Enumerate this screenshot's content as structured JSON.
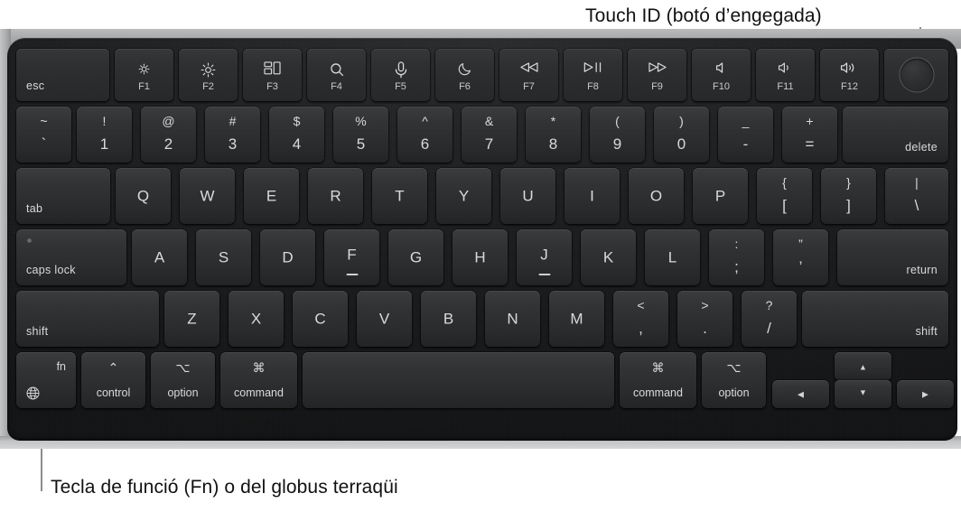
{
  "callouts": {
    "touch_id": "Touch ID (botó d’engegada)",
    "fn_key": "Tecla de funció (Fn) o del globus terraqüi"
  },
  "colors": {
    "page_background": "#ffffff",
    "chassis_metal": "#a9abad",
    "keyboard_well": "#1d1e20",
    "keycap": "#323335",
    "legend_text": "#d9dadb",
    "leader_line": "#8c8c8c"
  },
  "keyboard": {
    "layout": "Apple MacBook US English",
    "function_row": [
      {
        "name": "esc",
        "word": "esc"
      },
      {
        "name": "f1",
        "icon": "brightness-down-icon",
        "fn": "F1"
      },
      {
        "name": "f2",
        "icon": "brightness-up-icon",
        "fn": "F2"
      },
      {
        "name": "f3",
        "icon": "mission-control-icon",
        "fn": "F3"
      },
      {
        "name": "f4",
        "icon": "spotlight-search-icon",
        "fn": "F4"
      },
      {
        "name": "f5",
        "icon": "dictation-mic-icon",
        "fn": "F5"
      },
      {
        "name": "f6",
        "icon": "do-not-disturb-moon-icon",
        "fn": "F6"
      },
      {
        "name": "f7",
        "icon": "rewind-icon",
        "fn": "F7"
      },
      {
        "name": "f8",
        "icon": "play-pause-icon",
        "fn": "F8"
      },
      {
        "name": "f9",
        "icon": "fast-forward-icon",
        "fn": "F9"
      },
      {
        "name": "f10",
        "icon": "volume-mute-icon",
        "fn": "F10"
      },
      {
        "name": "f11",
        "icon": "volume-down-icon",
        "fn": "F11"
      },
      {
        "name": "f12",
        "icon": "volume-up-icon",
        "fn": "F12"
      },
      {
        "name": "touch-id",
        "icon": "touch-id-icon"
      }
    ],
    "number_row": [
      {
        "name": "grave",
        "upper": "~",
        "lower": "`"
      },
      {
        "name": "1",
        "upper": "!",
        "lower": "1"
      },
      {
        "name": "2",
        "upper": "@",
        "lower": "2"
      },
      {
        "name": "3",
        "upper": "#",
        "lower": "3"
      },
      {
        "name": "4",
        "upper": "$",
        "lower": "4"
      },
      {
        "name": "5",
        "upper": "%",
        "lower": "5"
      },
      {
        "name": "6",
        "upper": "^",
        "lower": "6"
      },
      {
        "name": "7",
        "upper": "&",
        "lower": "7"
      },
      {
        "name": "8",
        "upper": "*",
        "lower": "8"
      },
      {
        "name": "9",
        "upper": "(",
        "lower": "9"
      },
      {
        "name": "0",
        "upper": ")",
        "lower": "0"
      },
      {
        "name": "minus",
        "upper": "_",
        "lower": "-"
      },
      {
        "name": "equal",
        "upper": "+",
        "lower": "="
      },
      {
        "name": "delete",
        "word": "delete"
      }
    ],
    "top_row": [
      {
        "name": "tab",
        "word": "tab"
      },
      {
        "name": "q",
        "letter": "Q"
      },
      {
        "name": "w",
        "letter": "W"
      },
      {
        "name": "e",
        "letter": "E"
      },
      {
        "name": "r",
        "letter": "R"
      },
      {
        "name": "t",
        "letter": "T"
      },
      {
        "name": "y",
        "letter": "Y"
      },
      {
        "name": "u",
        "letter": "U"
      },
      {
        "name": "i",
        "letter": "I"
      },
      {
        "name": "o",
        "letter": "O"
      },
      {
        "name": "p",
        "letter": "P"
      },
      {
        "name": "bracket-left",
        "upper": "{",
        "lower": "["
      },
      {
        "name": "bracket-right",
        "upper": "}",
        "lower": "]"
      },
      {
        "name": "backslash",
        "upper": "|",
        "lower": "\\"
      }
    ],
    "home_row": [
      {
        "name": "caps-lock",
        "word": "caps lock"
      },
      {
        "name": "a",
        "letter": "A"
      },
      {
        "name": "s",
        "letter": "S"
      },
      {
        "name": "d",
        "letter": "D"
      },
      {
        "name": "f",
        "letter": "F",
        "homing": true
      },
      {
        "name": "g",
        "letter": "G"
      },
      {
        "name": "h",
        "letter": "H"
      },
      {
        "name": "j",
        "letter": "J",
        "homing": true
      },
      {
        "name": "k",
        "letter": "K"
      },
      {
        "name": "l",
        "letter": "L"
      },
      {
        "name": "semicolon",
        "upper": ":",
        "lower": ";"
      },
      {
        "name": "quote",
        "upper": "”",
        "lower": "’"
      },
      {
        "name": "return",
        "word": "return"
      }
    ],
    "bottom_letter_row": [
      {
        "name": "shift-left",
        "word": "shift"
      },
      {
        "name": "z",
        "letter": "Z"
      },
      {
        "name": "x",
        "letter": "X"
      },
      {
        "name": "c",
        "letter": "C"
      },
      {
        "name": "v",
        "letter": "V"
      },
      {
        "name": "b",
        "letter": "B"
      },
      {
        "name": "n",
        "letter": "N"
      },
      {
        "name": "m",
        "letter": "M"
      },
      {
        "name": "comma",
        "upper": "<",
        "lower": ","
      },
      {
        "name": "period",
        "upper": ">",
        "lower": "."
      },
      {
        "name": "slash",
        "upper": "?",
        "lower": "/"
      },
      {
        "name": "shift-right",
        "word": "shift"
      }
    ],
    "modifier_row": [
      {
        "name": "fn",
        "word": "fn",
        "icon": "globe-icon"
      },
      {
        "name": "control-left",
        "word": "control",
        "symbol": "⌃"
      },
      {
        "name": "option-left",
        "word": "option",
        "symbol": "⌥"
      },
      {
        "name": "command-left",
        "word": "command",
        "symbol": "⌘"
      },
      {
        "name": "space",
        "word": ""
      },
      {
        "name": "command-right",
        "word": "command",
        "symbol": "⌘"
      },
      {
        "name": "option-right",
        "word": "option",
        "symbol": "⌥"
      }
    ],
    "arrow_keys": [
      {
        "name": "arrow-left",
        "glyph": "◀"
      },
      {
        "name": "arrow-up",
        "glyph": "▲"
      },
      {
        "name": "arrow-down",
        "glyph": "▼"
      },
      {
        "name": "arrow-right",
        "glyph": "▶"
      }
    ]
  }
}
